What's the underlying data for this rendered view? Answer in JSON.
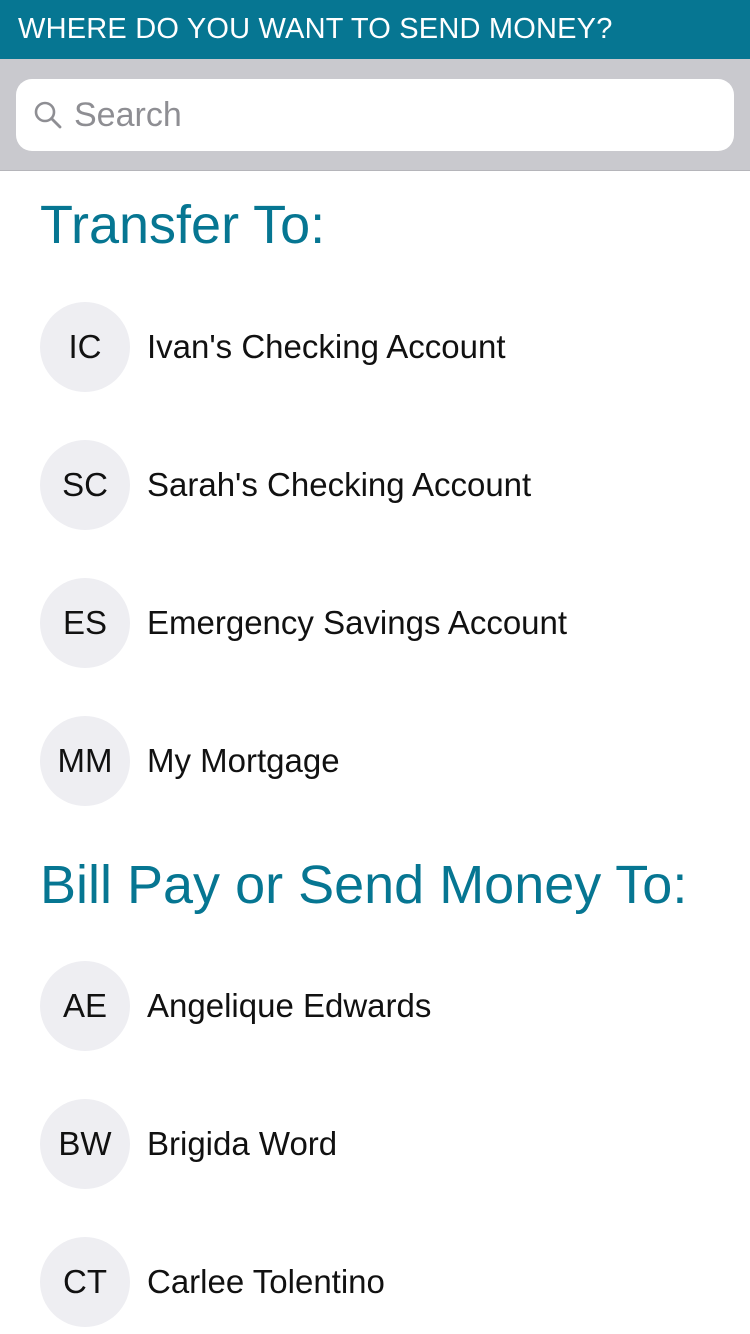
{
  "header": {
    "title": "WHERE DO YOU WANT TO SEND MONEY?"
  },
  "search": {
    "placeholder": "Search",
    "value": ""
  },
  "transfer_section": {
    "title": "Transfer To:",
    "items": [
      {
        "initials": "IC",
        "label": "Ivan's Checking Account"
      },
      {
        "initials": "SC",
        "label": "Sarah's Checking Account"
      },
      {
        "initials": "ES",
        "label": "Emergency Savings Account"
      },
      {
        "initials": "MM",
        "label": "My Mortgage"
      }
    ]
  },
  "billpay_section": {
    "title": "Bill Pay or Send Money To:",
    "items": [
      {
        "initials": "AE",
        "label": "Angelique Edwards"
      },
      {
        "initials": "BW",
        "label": "Brigida Word"
      },
      {
        "initials": "CT",
        "label": "Carlee Tolentino"
      }
    ]
  },
  "colors": {
    "accent": "#067692",
    "search_bar_bg": "#c9c9ce",
    "avatar_bg": "#eeeef2"
  }
}
